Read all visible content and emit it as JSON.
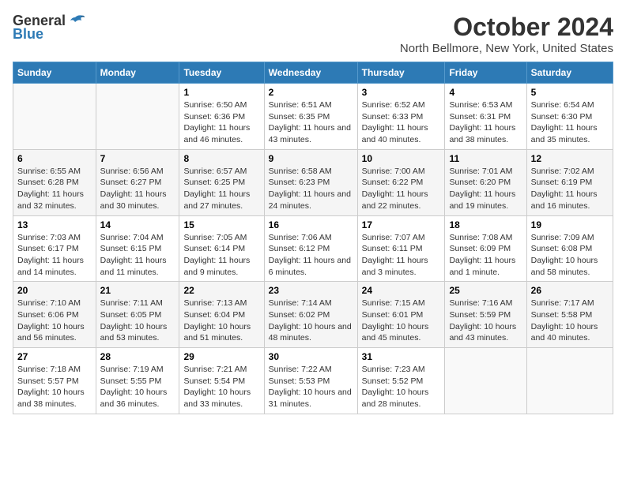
{
  "logo": {
    "general": "General",
    "blue": "Blue"
  },
  "title": "October 2024",
  "subtitle": "North Bellmore, New York, United States",
  "headers": [
    "Sunday",
    "Monday",
    "Tuesday",
    "Wednesday",
    "Thursday",
    "Friday",
    "Saturday"
  ],
  "weeks": [
    [
      {
        "day": "",
        "sunrise": "",
        "sunset": "",
        "daylight": ""
      },
      {
        "day": "",
        "sunrise": "",
        "sunset": "",
        "daylight": ""
      },
      {
        "day": "1",
        "sunrise": "Sunrise: 6:50 AM",
        "sunset": "Sunset: 6:36 PM",
        "daylight": "Daylight: 11 hours and 46 minutes."
      },
      {
        "day": "2",
        "sunrise": "Sunrise: 6:51 AM",
        "sunset": "Sunset: 6:35 PM",
        "daylight": "Daylight: 11 hours and 43 minutes."
      },
      {
        "day": "3",
        "sunrise": "Sunrise: 6:52 AM",
        "sunset": "Sunset: 6:33 PM",
        "daylight": "Daylight: 11 hours and 40 minutes."
      },
      {
        "day": "4",
        "sunrise": "Sunrise: 6:53 AM",
        "sunset": "Sunset: 6:31 PM",
        "daylight": "Daylight: 11 hours and 38 minutes."
      },
      {
        "day": "5",
        "sunrise": "Sunrise: 6:54 AM",
        "sunset": "Sunset: 6:30 PM",
        "daylight": "Daylight: 11 hours and 35 minutes."
      }
    ],
    [
      {
        "day": "6",
        "sunrise": "Sunrise: 6:55 AM",
        "sunset": "Sunset: 6:28 PM",
        "daylight": "Daylight: 11 hours and 32 minutes."
      },
      {
        "day": "7",
        "sunrise": "Sunrise: 6:56 AM",
        "sunset": "Sunset: 6:27 PM",
        "daylight": "Daylight: 11 hours and 30 minutes."
      },
      {
        "day": "8",
        "sunrise": "Sunrise: 6:57 AM",
        "sunset": "Sunset: 6:25 PM",
        "daylight": "Daylight: 11 hours and 27 minutes."
      },
      {
        "day": "9",
        "sunrise": "Sunrise: 6:58 AM",
        "sunset": "Sunset: 6:23 PM",
        "daylight": "Daylight: 11 hours and 24 minutes."
      },
      {
        "day": "10",
        "sunrise": "Sunrise: 7:00 AM",
        "sunset": "Sunset: 6:22 PM",
        "daylight": "Daylight: 11 hours and 22 minutes."
      },
      {
        "day": "11",
        "sunrise": "Sunrise: 7:01 AM",
        "sunset": "Sunset: 6:20 PM",
        "daylight": "Daylight: 11 hours and 19 minutes."
      },
      {
        "day": "12",
        "sunrise": "Sunrise: 7:02 AM",
        "sunset": "Sunset: 6:19 PM",
        "daylight": "Daylight: 11 hours and 16 minutes."
      }
    ],
    [
      {
        "day": "13",
        "sunrise": "Sunrise: 7:03 AM",
        "sunset": "Sunset: 6:17 PM",
        "daylight": "Daylight: 11 hours and 14 minutes."
      },
      {
        "day": "14",
        "sunrise": "Sunrise: 7:04 AM",
        "sunset": "Sunset: 6:15 PM",
        "daylight": "Daylight: 11 hours and 11 minutes."
      },
      {
        "day": "15",
        "sunrise": "Sunrise: 7:05 AM",
        "sunset": "Sunset: 6:14 PM",
        "daylight": "Daylight: 11 hours and 9 minutes."
      },
      {
        "day": "16",
        "sunrise": "Sunrise: 7:06 AM",
        "sunset": "Sunset: 6:12 PM",
        "daylight": "Daylight: 11 hours and 6 minutes."
      },
      {
        "day": "17",
        "sunrise": "Sunrise: 7:07 AM",
        "sunset": "Sunset: 6:11 PM",
        "daylight": "Daylight: 11 hours and 3 minutes."
      },
      {
        "day": "18",
        "sunrise": "Sunrise: 7:08 AM",
        "sunset": "Sunset: 6:09 PM",
        "daylight": "Daylight: 11 hours and 1 minute."
      },
      {
        "day": "19",
        "sunrise": "Sunrise: 7:09 AM",
        "sunset": "Sunset: 6:08 PM",
        "daylight": "Daylight: 10 hours and 58 minutes."
      }
    ],
    [
      {
        "day": "20",
        "sunrise": "Sunrise: 7:10 AM",
        "sunset": "Sunset: 6:06 PM",
        "daylight": "Daylight: 10 hours and 56 minutes."
      },
      {
        "day": "21",
        "sunrise": "Sunrise: 7:11 AM",
        "sunset": "Sunset: 6:05 PM",
        "daylight": "Daylight: 10 hours and 53 minutes."
      },
      {
        "day": "22",
        "sunrise": "Sunrise: 7:13 AM",
        "sunset": "Sunset: 6:04 PM",
        "daylight": "Daylight: 10 hours and 51 minutes."
      },
      {
        "day": "23",
        "sunrise": "Sunrise: 7:14 AM",
        "sunset": "Sunset: 6:02 PM",
        "daylight": "Daylight: 10 hours and 48 minutes."
      },
      {
        "day": "24",
        "sunrise": "Sunrise: 7:15 AM",
        "sunset": "Sunset: 6:01 PM",
        "daylight": "Daylight: 10 hours and 45 minutes."
      },
      {
        "day": "25",
        "sunrise": "Sunrise: 7:16 AM",
        "sunset": "Sunset: 5:59 PM",
        "daylight": "Daylight: 10 hours and 43 minutes."
      },
      {
        "day": "26",
        "sunrise": "Sunrise: 7:17 AM",
        "sunset": "Sunset: 5:58 PM",
        "daylight": "Daylight: 10 hours and 40 minutes."
      }
    ],
    [
      {
        "day": "27",
        "sunrise": "Sunrise: 7:18 AM",
        "sunset": "Sunset: 5:57 PM",
        "daylight": "Daylight: 10 hours and 38 minutes."
      },
      {
        "day": "28",
        "sunrise": "Sunrise: 7:19 AM",
        "sunset": "Sunset: 5:55 PM",
        "daylight": "Daylight: 10 hours and 36 minutes."
      },
      {
        "day": "29",
        "sunrise": "Sunrise: 7:21 AM",
        "sunset": "Sunset: 5:54 PM",
        "daylight": "Daylight: 10 hours and 33 minutes."
      },
      {
        "day": "30",
        "sunrise": "Sunrise: 7:22 AM",
        "sunset": "Sunset: 5:53 PM",
        "daylight": "Daylight: 10 hours and 31 minutes."
      },
      {
        "day": "31",
        "sunrise": "Sunrise: 7:23 AM",
        "sunset": "Sunset: 5:52 PM",
        "daylight": "Daylight: 10 hours and 28 minutes."
      },
      {
        "day": "",
        "sunrise": "",
        "sunset": "",
        "daylight": ""
      },
      {
        "day": "",
        "sunrise": "",
        "sunset": "",
        "daylight": ""
      }
    ]
  ]
}
